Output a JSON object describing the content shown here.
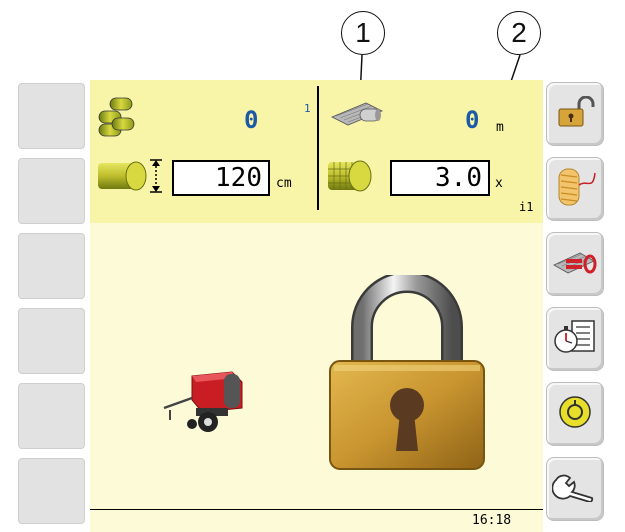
{
  "callouts": {
    "one": "1",
    "two": "2"
  },
  "bales": {
    "count": "0",
    "layer_count": "1",
    "diameter": "120",
    "diameter_unit": "cm"
  },
  "net": {
    "length": "0",
    "length_unit": "m",
    "wraps": "3.0",
    "wraps_unit": "x",
    "info": "i1"
  },
  "status": {
    "time": "16:18"
  },
  "icons": {
    "bales": "bale-stack-icon",
    "bale_diameter": "bale-diameter-icon",
    "net": "net-roll-icon",
    "net_wrap": "net-wrap-icon",
    "lock": "padlock-locked-icon",
    "baler": "round-baler-icon",
    "unlock_button": "unlock-icon",
    "twine_button": "twine-spool-icon",
    "reset_button": "net-counter-reset-icon",
    "timer_button": "stopwatch-list-icon",
    "circle_button": "round-function-icon",
    "settings_button": "wrench-icon"
  },
  "colors": {
    "panel_yellow": "#f9f5a8",
    "main_bg": "#fdfbd7",
    "value_blue": "#1c5aa8",
    "button_gray": "#e4e4e4"
  }
}
